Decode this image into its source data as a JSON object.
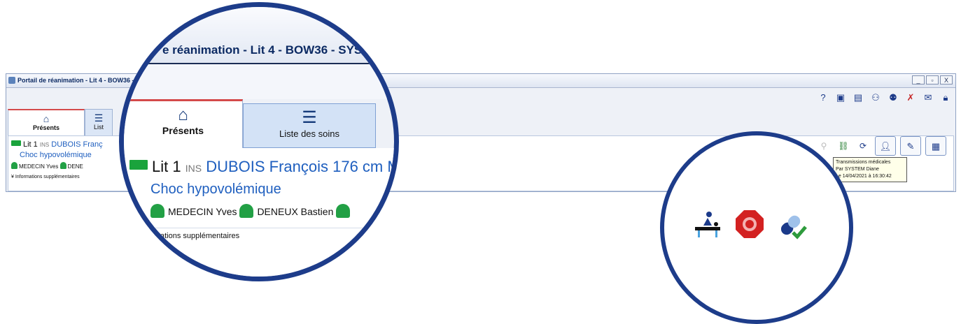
{
  "window": {
    "title": "Portail de réanimation - Lit 4 - BOW36 - SYS",
    "min": "_",
    "restore": "▫",
    "close": "X"
  },
  "toolbar_icons": [
    "help-icon",
    "id-card-icon",
    "printer-icon",
    "user-link-icon",
    "user-add-icon",
    "user-remove-icon",
    "mail-icon",
    "lock-icon"
  ],
  "tabs": [
    {
      "label": "Présents",
      "icon": "home-icon",
      "active": true
    },
    {
      "label": "Liste des soins",
      "icon": "checklist-icon",
      "active": false
    }
  ],
  "patient": {
    "bed": "Lit 1",
    "ins": "INS",
    "name": "DUBOIS François 176 cm M",
    "name_short": "DUBOIS Franç",
    "diagnosis": "Choc hypovolémique",
    "doctor": "MEDECIN Yves",
    "nurse": "DENEUX Bastien",
    "nurse_short": "DENE",
    "more_info": "Informations supplémentaires",
    "more_info_clipped": "formations supplémentaires"
  },
  "tooltip": {
    "line1": "Transmissions médicales",
    "line2": "Par SYSTEM Diane",
    "line3": "Le 14/04/2021 à 16:30:42"
  },
  "zoom_title": "e réanimation - Lit 4 - BOW36 - SYS",
  "zoom_icons": [
    "massage-table-icon",
    "covid-stop-icon",
    "medication-check-icon"
  ],
  "colors": {
    "accent": "#1d3c8a",
    "link": "#1f5fbf",
    "green": "#22a045",
    "active_tab": "#d44a4a"
  }
}
